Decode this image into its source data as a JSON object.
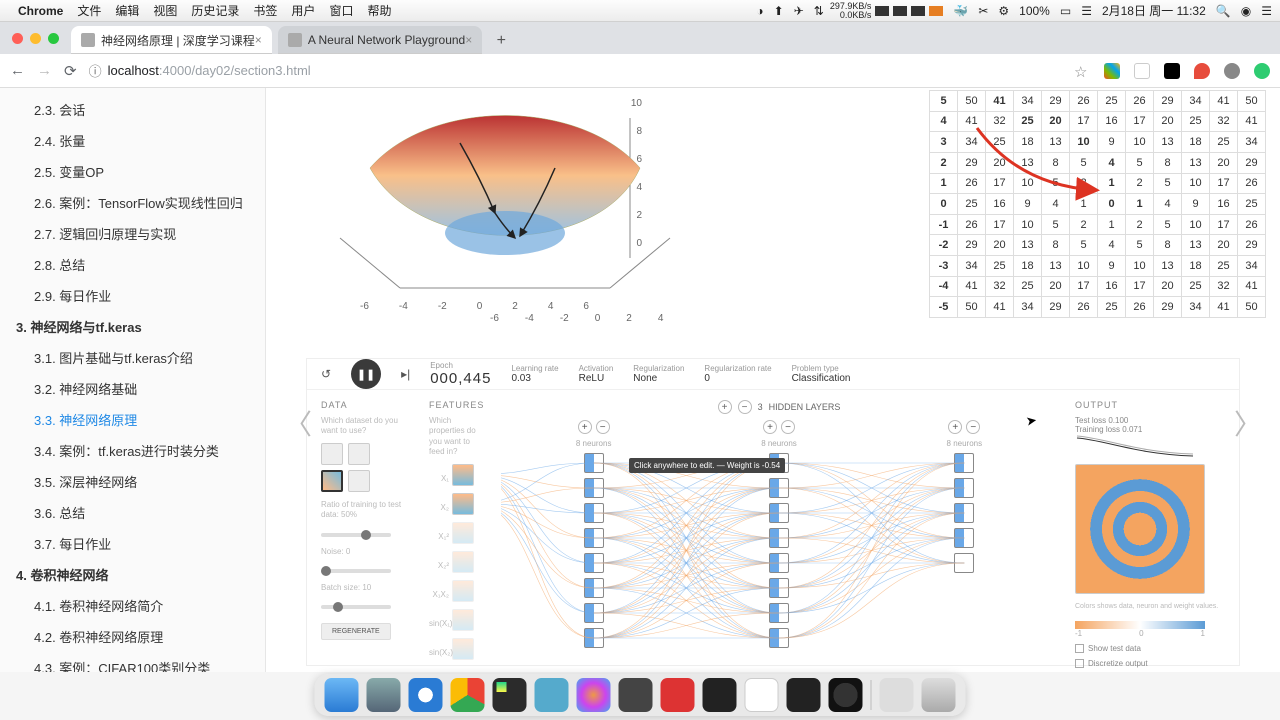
{
  "mac_menu": {
    "app": "Chrome",
    "items": [
      "文件",
      "编辑",
      "视图",
      "历史记录",
      "书签",
      "用户",
      "窗口",
      "帮助"
    ],
    "net_up": "297.9KB/s",
    "net_down": "0.0KB/s",
    "battery": "100%",
    "date": "2月18日 周一  11:32"
  },
  "tabs": [
    {
      "title": "神经网络原理 | 深度学习课程",
      "active": true
    },
    {
      "title": "A Neural Network Playground",
      "active": false
    }
  ],
  "url": {
    "scheme_icon": "ⓘ",
    "host": "localhost",
    "port": ":4000",
    "path": "/day02/section3.html"
  },
  "sidebar": {
    "items": [
      {
        "n": "2.3.",
        "t": "会话",
        "sub": true
      },
      {
        "n": "2.4.",
        "t": "张量",
        "sub": true
      },
      {
        "n": "2.5.",
        "t": "变量OP",
        "sub": true
      },
      {
        "n": "2.6.",
        "t": "案例：TensorFlow实现线性回归",
        "sub": true
      },
      {
        "n": "2.7.",
        "t": "逻辑回归原理与实现",
        "sub": true
      },
      {
        "n": "2.8.",
        "t": "总结",
        "sub": true
      },
      {
        "n": "2.9.",
        "t": "每日作业",
        "sub": true
      },
      {
        "n": "3.",
        "t": "神经网络与tf.keras",
        "sub": false
      },
      {
        "n": "3.1.",
        "t": "图片基础与tf.keras介绍",
        "sub": true
      },
      {
        "n": "3.2.",
        "t": "神经网络基础",
        "sub": true
      },
      {
        "n": "3.3.",
        "t": "神经网络原理",
        "sub": true,
        "active": true
      },
      {
        "n": "3.4.",
        "t": "案例：tf.keras进行时装分类",
        "sub": true
      },
      {
        "n": "3.5.",
        "t": "深层神经网络",
        "sub": true
      },
      {
        "n": "3.6.",
        "t": "总结",
        "sub": true
      },
      {
        "n": "3.7.",
        "t": "每日作业",
        "sub": true
      },
      {
        "n": "4.",
        "t": "卷积神经网络",
        "sub": false
      },
      {
        "n": "4.1.",
        "t": "卷积神经网络简介",
        "sub": true
      },
      {
        "n": "4.2.",
        "t": "卷积神经网络原理",
        "sub": true
      },
      {
        "n": "4.3.",
        "t": "案例：CIFAR100类别分类",
        "sub": true
      }
    ]
  },
  "surface": {
    "y_ticks": [
      "10",
      "8",
      "6",
      "4",
      "2",
      "0"
    ],
    "x_ticks_a": [
      "-6",
      "-4",
      "-2",
      "0",
      "2",
      "4",
      "6"
    ],
    "x_ticks_b": [
      "-6",
      "-4",
      "-2",
      "0",
      "2",
      "4"
    ]
  },
  "chart_data": {
    "type": "table",
    "row_labels": [
      "5",
      "4",
      "3",
      "2",
      "1",
      "0",
      "-1",
      "-2",
      "-3",
      "-4",
      "-5"
    ],
    "rows": [
      [
        50,
        41,
        34,
        29,
        26,
        25,
        26,
        29,
        34,
        41,
        50
      ],
      [
        41,
        32,
        25,
        20,
        17,
        16,
        17,
        20,
        25,
        32,
        41
      ],
      [
        34,
        25,
        18,
        13,
        10,
        9,
        10,
        13,
        18,
        25,
        34
      ],
      [
        29,
        20,
        13,
        8,
        5,
        4,
        5,
        8,
        13,
        20,
        29
      ],
      [
        26,
        17,
        10,
        5,
        2,
        1,
        2,
        5,
        10,
        17,
        26
      ],
      [
        25,
        16,
        9,
        4,
        1,
        0,
        1,
        4,
        9,
        16,
        25
      ],
      [
        26,
        17,
        10,
        5,
        2,
        1,
        2,
        5,
        10,
        17,
        26
      ],
      [
        29,
        20,
        13,
        8,
        5,
        4,
        5,
        8,
        13,
        20,
        29
      ],
      [
        34,
        25,
        18,
        13,
        10,
        9,
        10,
        13,
        18,
        25,
        34
      ],
      [
        41,
        32,
        25,
        20,
        17,
        16,
        17,
        20,
        25,
        32,
        41
      ],
      [
        50,
        41,
        34,
        29,
        26,
        25,
        26,
        29,
        34,
        41,
        50
      ]
    ],
    "highlight_path": [
      [
        0,
        1
      ],
      [
        1,
        2
      ],
      [
        1,
        3
      ],
      [
        2,
        4
      ],
      [
        3,
        5
      ],
      [
        4,
        5
      ],
      [
        5,
        5
      ],
      [
        5,
        6
      ]
    ]
  },
  "playground": {
    "epoch_label": "Epoch",
    "epoch": "000,445",
    "learning_rate_label": "Learning rate",
    "learning_rate": "0.03",
    "activation_label": "Activation",
    "activation": "ReLU",
    "regularization_label": "Regularization",
    "regularization": "None",
    "reg_rate_label": "Regularization rate",
    "reg_rate": "0",
    "problem_label": "Problem type",
    "problem": "Classification",
    "data_title": "DATA",
    "data_sub": "Which dataset do you want to use?",
    "ratio_label": "Ratio of training to test data: 50%",
    "noise_label": "Noise: 0",
    "batch_label": "Batch size: 10",
    "regen": "REGENERATE",
    "features_title": "FEATURES",
    "features_sub": "Which properties do you want to feed in?",
    "feature_names": [
      "X₁",
      "X₂",
      "X₁²",
      "X₂²",
      "X₁X₂",
      "sin(X₁)",
      "sin(X₂)"
    ],
    "hidden_label": "HIDDEN LAYERS",
    "hidden_count": "3",
    "layer_neurons": [
      "8 neurons",
      "8 neurons",
      "8 neurons"
    ],
    "tooltip": "Click anywhere to edit.\nWeight is -0.54",
    "output_title": "OUTPUT",
    "test_loss": "Test loss 0.100",
    "train_loss": "Training loss 0.071",
    "colors_caption": "Colors shows data, neuron and weight values.",
    "scale_labels": [
      "-1",
      "0",
      "1"
    ],
    "show_test": "Show test data",
    "discretize": "Discretize output"
  }
}
